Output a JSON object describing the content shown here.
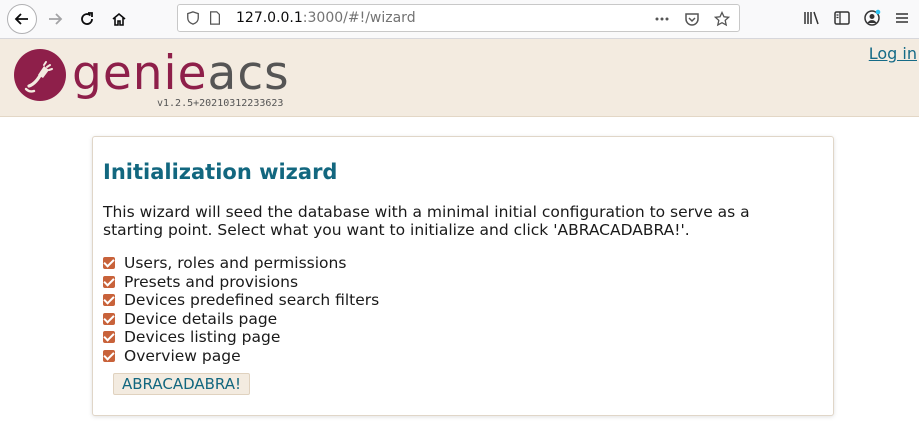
{
  "browser": {
    "url_host": "127.0.0.1",
    "url_rest": ":3000/#!/wizard",
    "icons": {
      "back": "arrow-left-icon",
      "forward": "arrow-right-icon",
      "reload": "reload-icon",
      "home": "home-icon",
      "info": "shield-icon",
      "page": "page-icon",
      "more": "more-icon",
      "pocket": "pocket-icon",
      "bookmark": "star-icon",
      "library": "library-icon",
      "sidebar": "sidebar-icon",
      "account": "account-icon",
      "menu": "hamburger-menu-icon"
    }
  },
  "header": {
    "logo_text_part1": "genie",
    "logo_text_part2": "acs",
    "version": "v1.2.5+20210312233623",
    "login_label": "Log in",
    "colors": {
      "brand": "#8e1f4a",
      "header_bg": "#f3ebe0",
      "link": "#156b87"
    }
  },
  "wizard": {
    "title": "Initialization wizard",
    "description": "This wizard will seed the database with a minimal initial configuration to serve as a starting point. Select what you want to initialize and click 'ABRACADABRA!'.",
    "options": [
      {
        "label": "Users, roles and permissions",
        "checked": true
      },
      {
        "label": "Presets and provisions",
        "checked": true
      },
      {
        "label": "Devices predefined search filters",
        "checked": true
      },
      {
        "label": "Device details page",
        "checked": true
      },
      {
        "label": "Devices listing page",
        "checked": true
      },
      {
        "label": "Overview page",
        "checked": true
      }
    ],
    "submit_label": "ABRACADABRA!",
    "colors": {
      "title": "#12677f",
      "checkbox": "#c8623a"
    }
  }
}
